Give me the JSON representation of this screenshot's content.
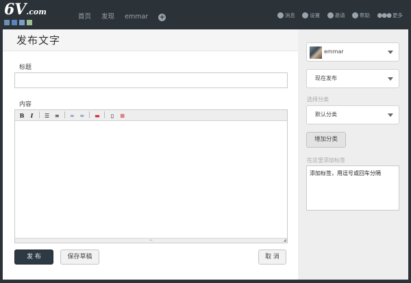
{
  "logo": {
    "main": "6V",
    "suffix": ".com",
    "square_colors": [
      "#6b8fb5",
      "#5c84b8",
      "#7aa0c8",
      "#9fbf90"
    ]
  },
  "nav": {
    "left": [
      "首页",
      "发现",
      "emmar"
    ],
    "plus": "+",
    "right": [
      {
        "icon": "mail-icon",
        "label": "消息"
      },
      {
        "icon": "gear-icon",
        "label": "设置"
      },
      {
        "icon": "user-icon",
        "label": "邀请"
      },
      {
        "icon": "help-icon",
        "label": "帮助"
      },
      {
        "icon": "more-icon",
        "label": "更多"
      }
    ]
  },
  "main": {
    "title": "发布文字",
    "title_label": "标题",
    "title_value": "",
    "content_label": "内容",
    "toolbar": [
      {
        "name": "bold-tool",
        "glyph": "B"
      },
      {
        "name": "italic-tool",
        "glyph": "I"
      },
      {
        "name": "bullet-list-tool",
        "glyph": "☰"
      },
      {
        "name": "numbered-list-tool",
        "glyph": "≡"
      },
      {
        "name": "link-tool",
        "glyph": "∞"
      },
      {
        "name": "unlink-tool",
        "glyph": "≈"
      },
      {
        "name": "image-tool",
        "glyph": "▬"
      },
      {
        "name": "source-tool",
        "glyph": "▯"
      },
      {
        "name": "fullscreen-tool",
        "glyph": "⊠"
      }
    ],
    "publish_label": "发 布",
    "draft_label": "保存草稿",
    "cancel_label": "取 消"
  },
  "sidebar": {
    "user_select": "emmar",
    "publish_time_select": "现在发布",
    "category_label": "选择分类",
    "category_select": "默认分类",
    "add_category_label": "增加分类",
    "tags_label": "在这里添加标签",
    "tags_placeholder": "添加标签，用逗号或回车分隔"
  }
}
